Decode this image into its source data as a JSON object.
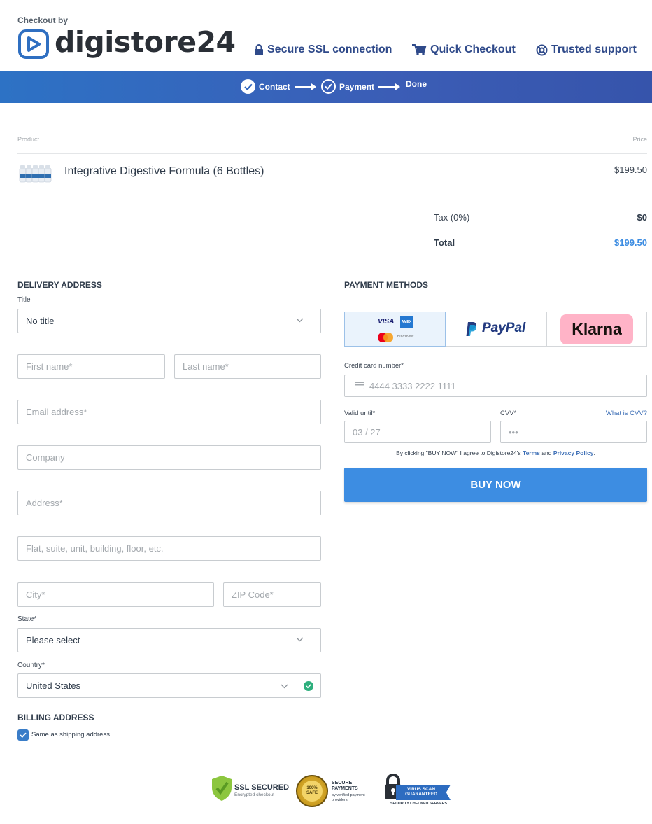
{
  "header": {
    "checkout_by": "Checkout by",
    "brand": "digistore24",
    "features": [
      {
        "icon": "lock-icon",
        "label": "Secure SSL connection"
      },
      {
        "icon": "cart-icon",
        "label": "Quick Checkout"
      },
      {
        "icon": "lifebuoy-icon",
        "label": "Trusted support"
      }
    ]
  },
  "steps": {
    "contact": "Contact",
    "payment": "Payment",
    "done": "Done"
  },
  "order": {
    "product_col": "Product",
    "price_col": "Price",
    "product_name": "Integrative Digestive Formula (6 Bottles)",
    "product_price": "$199.50",
    "tax_label": "Tax (0%)",
    "tax_value": "$0",
    "total_label": "Total",
    "total_value": "$199.50"
  },
  "delivery": {
    "heading": "DELIVERY ADDRESS",
    "title_label": "Title",
    "title_value": "No title",
    "first_name": "First name*",
    "last_name": "Last name*",
    "email": "Email address*",
    "company": "Company",
    "address": "Address*",
    "address2": "Flat, suite, unit, building, floor, etc.",
    "city": "City*",
    "zip": "ZIP Code*",
    "state_label": "State*",
    "state_value": "Please select",
    "country_label": "Country*",
    "country_value": "United States"
  },
  "billing": {
    "heading": "BILLING ADDRESS",
    "same_label": "Same as shipping address",
    "same_checked": true
  },
  "payment": {
    "heading": "PAYMENT METHODS",
    "methods": [
      "Credit card",
      "PayPal",
      "Klarna"
    ],
    "card_visa": "VISA",
    "card_amex": "AMEX",
    "card_discover": "DISCOVER",
    "paypal_label": "PayPal",
    "klarna_label": "Klarna",
    "cc_label": "Credit card number*",
    "cc_placeholder": "4444 3333 2222 1111",
    "valid_label": "Valid until*",
    "valid_placeholder": "03 / 27",
    "cvv_label": "CVV*",
    "cvv_help": "What is CVV?",
    "cvv_placeholder": "•••",
    "agree_prefix": "By clicking \"BUY NOW\" I agree to Digistore24's",
    "terms": "Terms",
    "and": "and",
    "privacy": "Privacy Policy",
    "agree_suffix": ".",
    "buy_button": "BUY NOW"
  },
  "trust": {
    "ssl_title": "SSL SECURED",
    "ssl_sub": "Encrypted checkout",
    "seal_text": "100% SAFE",
    "secure_title": "SECURE PAYMENTS",
    "secure_sub": "by verified payment providers",
    "virus_title": "VIRUS SCAN GUARANTEED",
    "virus_sub": "SECURITY CHECKED SERVERS"
  },
  "colors": {
    "brand_blue": "#3d8de2",
    "bar_start": "#2d72c5",
    "bar_end": "#3654ab",
    "total_blue": "#3d8de2",
    "klarna_pink": "#ffb3c7",
    "paypal_dark": "#253b80",
    "paypal_light": "#179bd7",
    "valid_green": "#2eaf7d"
  }
}
